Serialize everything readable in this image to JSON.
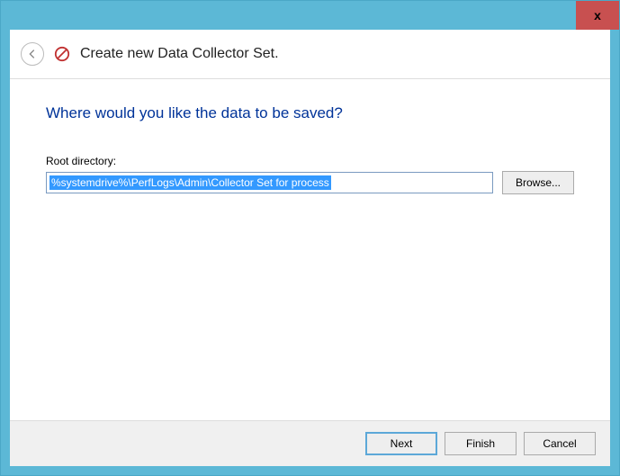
{
  "titlebar": {
    "close_label": "x"
  },
  "header": {
    "wizard_title": "Create new Data Collector Set."
  },
  "content": {
    "question": "Where would you like the data to be saved?",
    "root_directory_label": "Root directory:",
    "root_directory_value": "%systemdrive%\\PerfLogs\\Admin\\Collector Set for process",
    "browse_label": "Browse..."
  },
  "footer": {
    "next_label": "Next",
    "finish_label": "Finish",
    "cancel_label": "Cancel"
  }
}
